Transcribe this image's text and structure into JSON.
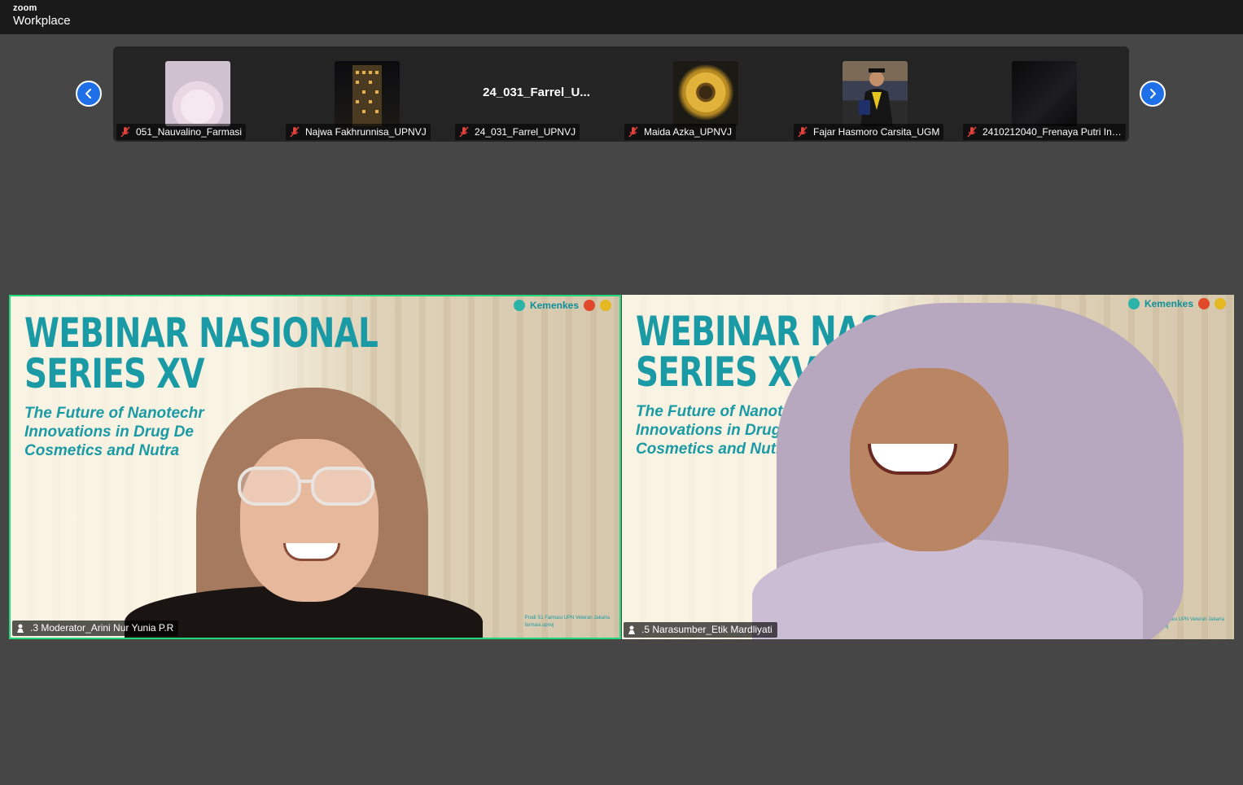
{
  "app": {
    "brand_top": "zoom",
    "brand_bottom": "Workplace"
  },
  "gallery": {
    "participants": [
      {
        "name": "051_Nauvalino_Farmasi",
        "art": "anime",
        "muted": true
      },
      {
        "name": "Najwa Fakhrunnisa_UPNVJ",
        "art": "night",
        "muted": true
      },
      {
        "name": "24_031_Farrel_UPNVJ",
        "thumb_text": "24_031_Farrel_U...",
        "muted": true
      },
      {
        "name": "Maida Azka_UPNVJ",
        "art": "sunflower",
        "muted": true
      },
      {
        "name": "Fajar Hasmoro Carsita_UGM",
        "art": "graduation",
        "muted": true
      },
      {
        "name": "2410212040_Frenaya Putri Ind...",
        "art": "dark",
        "muted": true
      }
    ]
  },
  "slide": {
    "title_line1": "WEBINAR NASIONAL",
    "title_line2": "SERIES XV",
    "sub_line1_a": "The Future of Nanotechr",
    "sub_line2_a": "Innovations in Drug De",
    "sub_line3_a": "Cosmetics and Nutra",
    "sub_line1_b": "The Future of Nanote",
    "sub_line2_b": "Innovations in Drug I",
    "sub_line3_b": "Cosmetics and Nutra",
    "title_line1_b": "WEBINAR NASIO",
    "logo_text": "Kemenkes",
    "footer_1": "Prodi S1 Farmasi UPN Veteran Jakarta",
    "footer_2": "farmasi.upnvj"
  },
  "videos": [
    {
      "name": ".3 Moderator_Arini Nur Yunia P.R",
      "active_speaker": true
    },
    {
      "name": ".5 Narasumber_Etik Mardliyati",
      "active_speaker": false
    }
  ],
  "colors": {
    "accent_blue": "#1f6fe8",
    "active_border": "#23d97a",
    "mic_off": "#e0423a",
    "slide_teal": "#1a9aa5"
  }
}
